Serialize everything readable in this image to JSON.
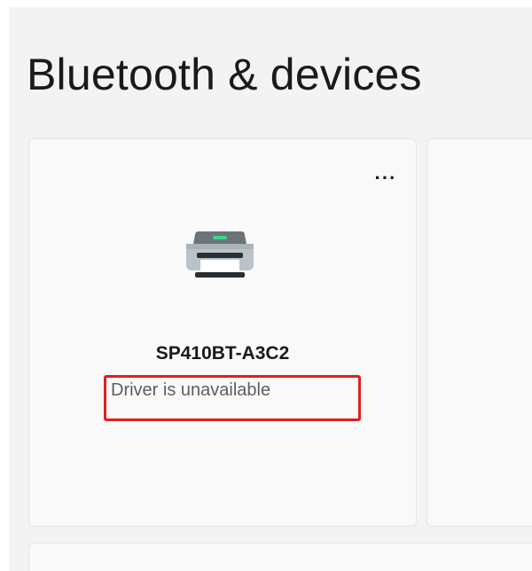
{
  "page": {
    "title": "Bluetooth & devices"
  },
  "device_card": {
    "more_label": "···",
    "icon": "printer-icon",
    "name": "SP410BT-A3C2",
    "status": "Driver is unavailable"
  },
  "colors": {
    "window_background": "#f3f3f3",
    "card_background": "#f9f9f9",
    "highlight": "#e0201b",
    "printer_indicator": "#3dd68c"
  }
}
